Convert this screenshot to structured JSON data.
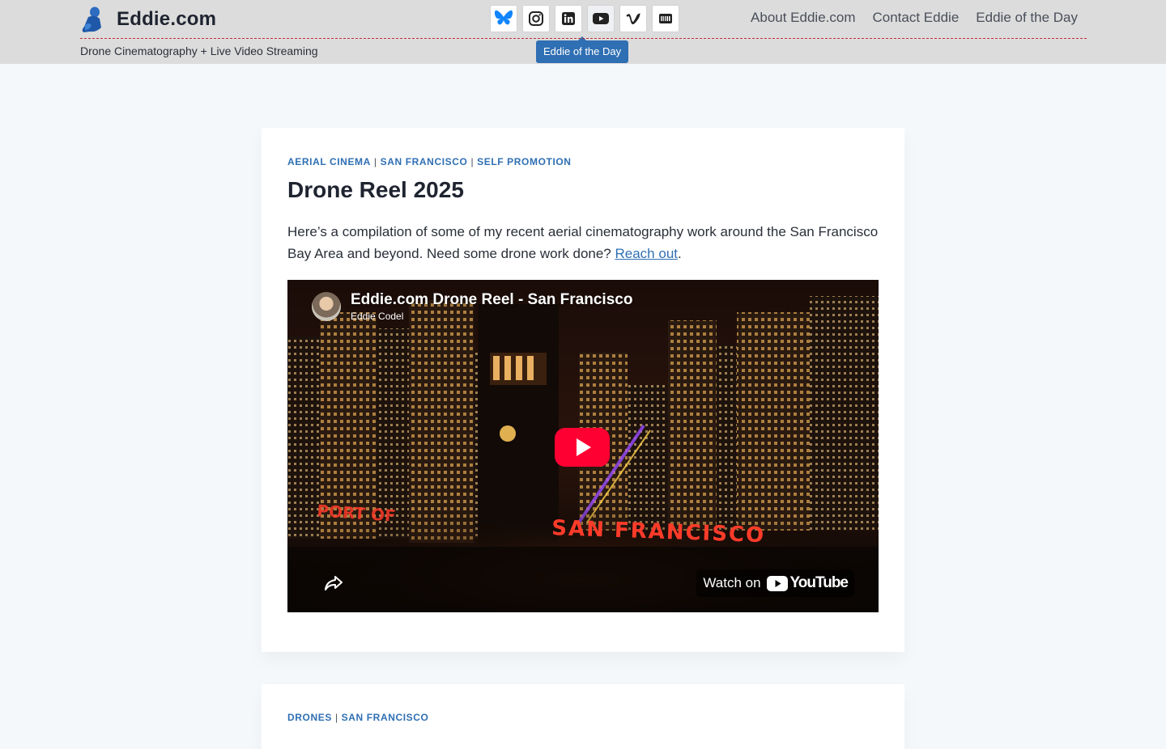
{
  "header": {
    "site_title": "Eddie.com",
    "tagline": "Drone Cinematography + Live Video Streaming",
    "social": [
      {
        "name": "bluesky",
        "icon": "butterfly-icon"
      },
      {
        "name": "instagram",
        "icon": "instagram-icon"
      },
      {
        "name": "linkedin",
        "icon": "linkedin-icon"
      },
      {
        "name": "youtube",
        "icon": "youtube-icon"
      },
      {
        "name": "vimeo",
        "icon": "vimeo-icon"
      },
      {
        "name": "imdb",
        "icon": "imdb-icon"
      }
    ],
    "tooltip": "Eddie of the Day",
    "nav": [
      "About Eddie.com",
      "Contact Eddie",
      "Eddie of the Day"
    ]
  },
  "post1": {
    "categories": [
      "AERIAL CINEMA",
      "SAN FRANCISCO",
      "SELF PROMOTION"
    ],
    "category_separator": "|",
    "title": "Drone Reel 2025",
    "excerpt_before": "Here’s a compilation of some of my recent aerial cinematography work around the San Francisco Bay Area and beyond. Need some drone work done? ",
    "excerpt_link": "Reach out",
    "excerpt_after": ".",
    "video": {
      "title": "Eddie.com Drone Reel - San Francisco",
      "channel": "Eddie Codel",
      "watch_on": "Watch on",
      "youtube_word": "YouTube",
      "neon_left": "PORT OF",
      "neon_main": "SAN FRANCISCO"
    }
  },
  "post2": {
    "categories": [
      "DRONES",
      "SAN FRANCISCO"
    ]
  },
  "colors": {
    "header_bg": "#dcdcdc",
    "accent_blue": "#2f6fb3",
    "divider_red": "#c0303a",
    "youtube_red": "#ff0033",
    "neon_red": "#ff3b2a"
  }
}
